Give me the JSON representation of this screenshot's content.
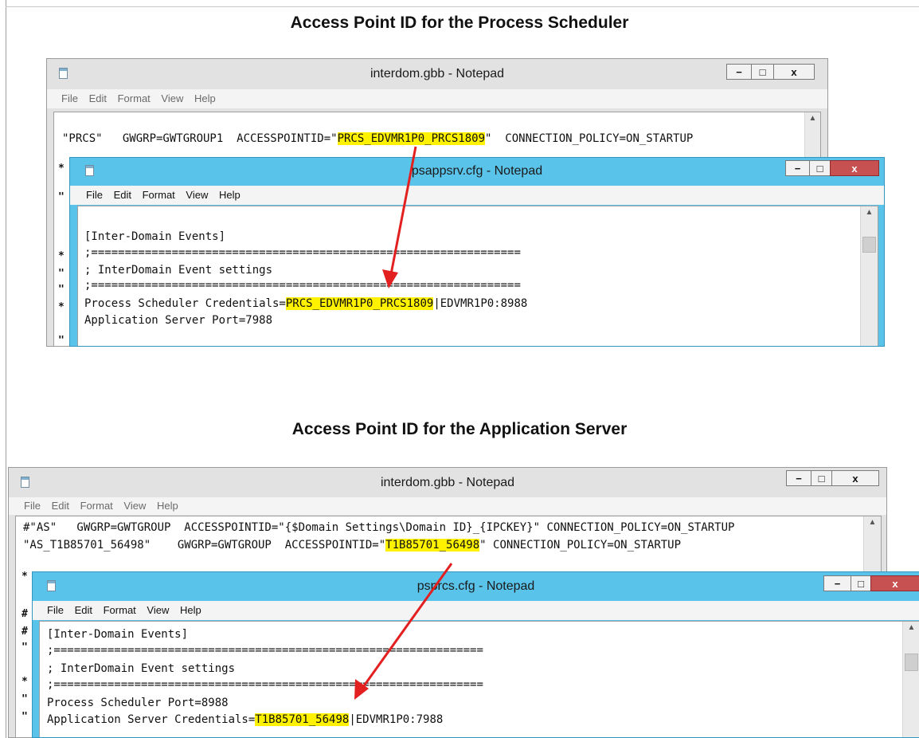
{
  "top_heading": "Access Point ID for the Process Scheduler",
  "bottom_heading": "Access Point ID for the Application Server",
  "menu": [
    "File",
    "Edit",
    "Format",
    "View",
    "Help"
  ],
  "controls": {
    "minimize": "−",
    "maximize": "□",
    "close": "x"
  },
  "w1": {
    "title": "interdom.gbb - Notepad",
    "l1_a": "\"PRCS\"   GWGRP=GWTGROUP1  ACCESSPOINTID=\"",
    "l1_hl": "PRCS_EDVMR1P0_PRCS1809",
    "l1_b": "\"  CONNECTION_POLICY=ON_STARTUP"
  },
  "w2": {
    "title": "psappsrv.cfg - Notepad",
    "l1": "[Inter-Domain Events]",
    "l2": ";================================================================",
    "l3": "; InterDomain Event settings",
    "l4": ";================================================================",
    "l5_a": "Process Scheduler Credentials=",
    "l5_hl": "PRCS_EDVMR1P0_PRCS1809",
    "l5_b": "|EDVMR1P0:8988",
    "l6": "Application Server Port=7988"
  },
  "w3": {
    "title": "interdom.gbb - Notepad",
    "l1": "#\"AS\"   GWGRP=GWTGROUP  ACCESSPOINTID=\"{$Domain Settings\\Domain ID}_{IPCKEY}\" CONNECTION_POLICY=ON_STARTUP",
    "l2_a": "\"AS_T1B85701_56498\"    GWGRP=GWTGROUP  ACCESSPOINTID=\"",
    "l2_hl": "T1B85701_56498",
    "l2_b": "\" CONNECTION_POLICY=ON_STARTUP"
  },
  "w4": {
    "title": "psprcs.cfg - Notepad",
    "l1": "[Inter-Domain Events]",
    "l2": ";================================================================",
    "l3": "; InterDomain Event settings",
    "l4": ";================================================================",
    "l5": "Process Scheduler Port=8988",
    "l6_a": "Application Server Credentials=",
    "l6_hl": "T1B85701_56498",
    "l6_b": "|EDVMR1P0:7988"
  },
  "colors": {
    "highlight": "#fff200",
    "arrow": "#e32020",
    "active_titlebar": "#5ac3ea",
    "close_button": "#c75050"
  }
}
